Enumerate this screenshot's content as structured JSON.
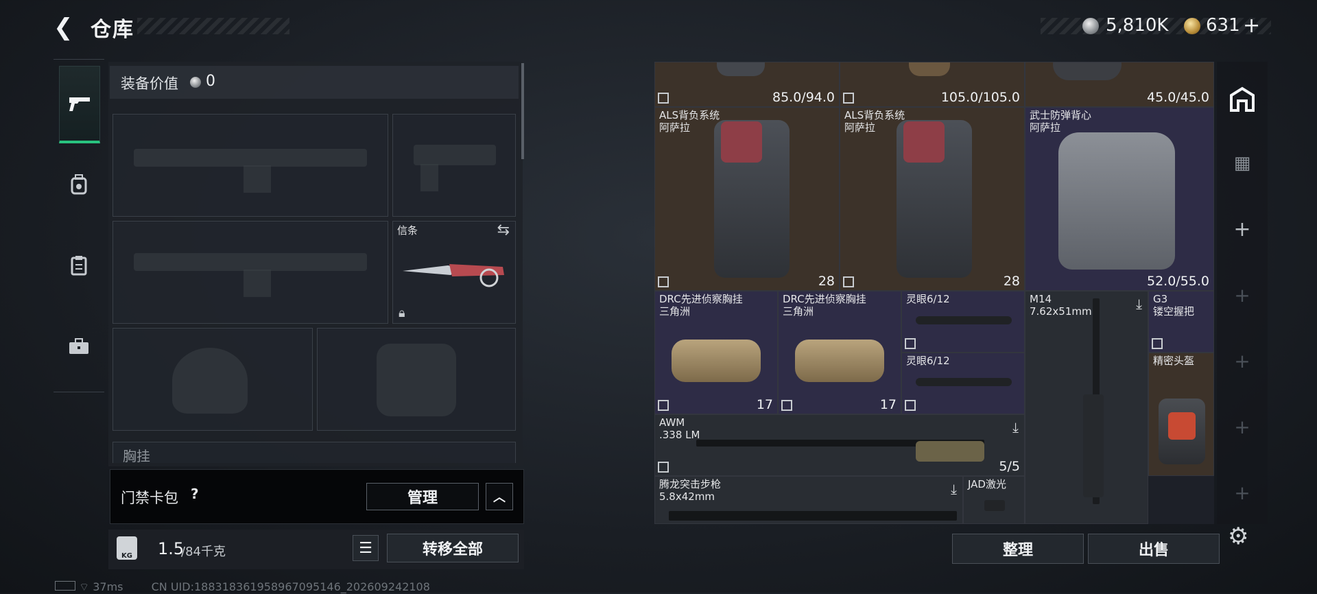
{
  "header": {
    "title": "仓库"
  },
  "currency": {
    "silver": "5,810K",
    "gold": "631",
    "gold_plus": "+"
  },
  "left_nav": {
    "items": [
      {
        "name": "weapons",
        "icon": "pistol-icon"
      },
      {
        "name": "backpack",
        "icon": "backpack-icon"
      },
      {
        "name": "clipboard",
        "icon": "clipboard-icon"
      },
      {
        "name": "case",
        "icon": "briefcase-icon"
      }
    ]
  },
  "equipment": {
    "value_label": "装备价值",
    "value": "0",
    "knife_label": "信条",
    "chest_label_partial": "胸挂"
  },
  "access": {
    "label": "门禁卡包",
    "help": "?",
    "manage_button": "管理",
    "collapse_icon": "chevron-up-icon"
  },
  "weight": {
    "current": "1.5",
    "max_text": "/84千克",
    "transfer_all_button": "转移全部"
  },
  "status": {
    "ping": "37ms",
    "uid": "CN UID:1883183619589670951​46_202609242108"
  },
  "inventory": {
    "top_row": [
      {
        "durability": "85.0/94.0"
      },
      {
        "durability": "105.0/105.0"
      },
      {
        "durability": "45.0/45.0"
      }
    ],
    "items": [
      {
        "name": "ALS背负系统",
        "sub": "阿萨拉",
        "count": "28"
      },
      {
        "name": "ALS背负系统",
        "sub": "阿萨拉",
        "count": "28"
      },
      {
        "name": "武士防弹背心",
        "sub": "阿萨拉",
        "durability": "52.0/55.0"
      },
      {
        "name": "DRC先进侦察胸挂",
        "sub": "三角洲",
        "count": "17"
      },
      {
        "name": "DRC先进侦察胸挂",
        "sub": "三角洲",
        "count": "17"
      },
      {
        "name": "灵眼6/12",
        "sub": ""
      },
      {
        "name": "灵眼6/12",
        "sub": ""
      },
      {
        "name": "M14",
        "sub": "7.62x51mm"
      },
      {
        "name": "G3",
        "sub": "镂空握把"
      },
      {
        "name": "精密头盔",
        "sub": ""
      },
      {
        "name": "AWM",
        "sub": ".338 LM",
        "ammo": "5/5"
      },
      {
        "name": "腾龙突击步枪",
        "sub": "5.8x42mm"
      },
      {
        "name": "JAD激光",
        "sub": ""
      }
    ],
    "sort_button": "整理",
    "sell_button": "出售"
  },
  "colors": {
    "accent_green": "#29c27f",
    "brown_cell": "#3c3229",
    "purple_cell": "#2e2c46"
  }
}
